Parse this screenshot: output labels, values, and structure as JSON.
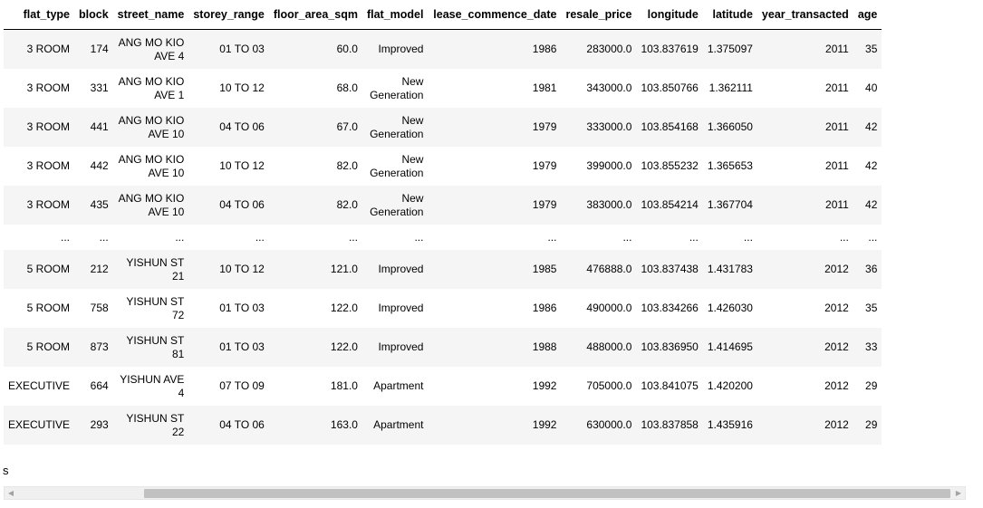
{
  "table": {
    "columns": [
      "flat_type",
      "block",
      "street_name",
      "storey_range",
      "floor_area_sqm",
      "flat_model",
      "lease_commence_date",
      "resale_price",
      "longitude",
      "latitude",
      "year_transacted",
      "age"
    ],
    "rows_top": [
      [
        "3 ROOM",
        "174",
        "ANG MO KIO AVE 4",
        "01 TO 03",
        "60.0",
        "Improved",
        "1986",
        "283000.0",
        "103.837619",
        "1.375097",
        "2011",
        "35"
      ],
      [
        "3 ROOM",
        "331",
        "ANG MO KIO AVE 1",
        "10 TO 12",
        "68.0",
        "New Generation",
        "1981",
        "343000.0",
        "103.850766",
        "1.362111",
        "2011",
        "40"
      ],
      [
        "3 ROOM",
        "441",
        "ANG MO KIO AVE 10",
        "04 TO 06",
        "67.0",
        "New Generation",
        "1979",
        "333000.0",
        "103.854168",
        "1.366050",
        "2011",
        "42"
      ],
      [
        "3 ROOM",
        "442",
        "ANG MO KIO AVE 10",
        "10 TO 12",
        "82.0",
        "New Generation",
        "1979",
        "399000.0",
        "103.855232",
        "1.365653",
        "2011",
        "42"
      ],
      [
        "3 ROOM",
        "435",
        "ANG MO KIO AVE 10",
        "04 TO 06",
        "82.0",
        "New Generation",
        "1979",
        "383000.0",
        "103.854214",
        "1.367704",
        "2011",
        "42"
      ]
    ],
    "ellipsis": "...",
    "rows_bottom": [
      [
        "5 ROOM",
        "212",
        "YISHUN ST 21",
        "10 TO 12",
        "121.0",
        "Improved",
        "1985",
        "476888.0",
        "103.837438",
        "1.431783",
        "2012",
        "36"
      ],
      [
        "5 ROOM",
        "758",
        "YISHUN ST 72",
        "01 TO 03",
        "122.0",
        "Improved",
        "1986",
        "490000.0",
        "103.834266",
        "1.426030",
        "2012",
        "35"
      ],
      [
        "5 ROOM",
        "873",
        "YISHUN ST 81",
        "01 TO 03",
        "122.0",
        "Improved",
        "1988",
        "488000.0",
        "103.836950",
        "1.414695",
        "2012",
        "33"
      ],
      [
        "EXECUTIVE",
        "664",
        "YISHUN AVE 4",
        "07 TO 09",
        "181.0",
        "Apartment",
        "1992",
        "705000.0",
        "103.841075",
        "1.420200",
        "2012",
        "29"
      ],
      [
        "EXECUTIVE",
        "293",
        "YISHUN ST 22",
        "04 TO 06",
        "163.0",
        "Apartment",
        "1992",
        "630000.0",
        "103.837858",
        "1.435916",
        "2012",
        "29"
      ]
    ]
  },
  "shape_text": "s",
  "scrollbar": {
    "left_arrow": "◀",
    "right_arrow": "▶"
  }
}
